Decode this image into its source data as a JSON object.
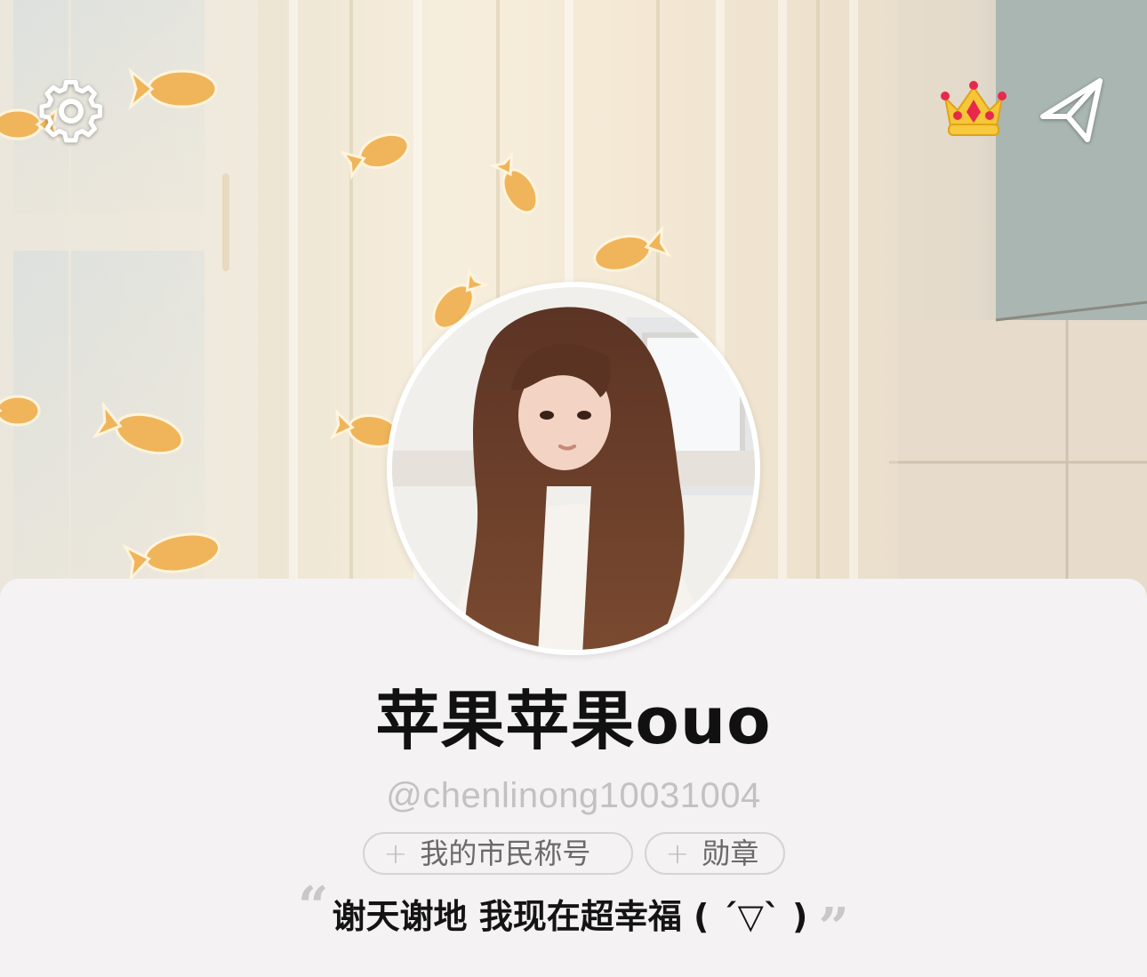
{
  "header": {
    "settings_icon": "gear-icon",
    "vip_icon": "crown-icon",
    "share_icon": "paper-plane-icon"
  },
  "profile": {
    "nickname": "苹果苹果ouo",
    "handle": "@chenlinong10031004",
    "tags": [
      {
        "plus": "+",
        "label": "我的市民称号"
      },
      {
        "plus": "+",
        "label": "勋章"
      }
    ],
    "bio_open_quote": "“",
    "bio": "谢天谢地 我现在超幸福 ( ´▽` )",
    "bio_close_quote": "”"
  },
  "colors": {
    "card_background": "#f4f2f3",
    "nickname": "#111111",
    "handle": "#c2c2c2",
    "tag_border": "#d4d4d4",
    "tag_text": "#6a6a6a"
  }
}
